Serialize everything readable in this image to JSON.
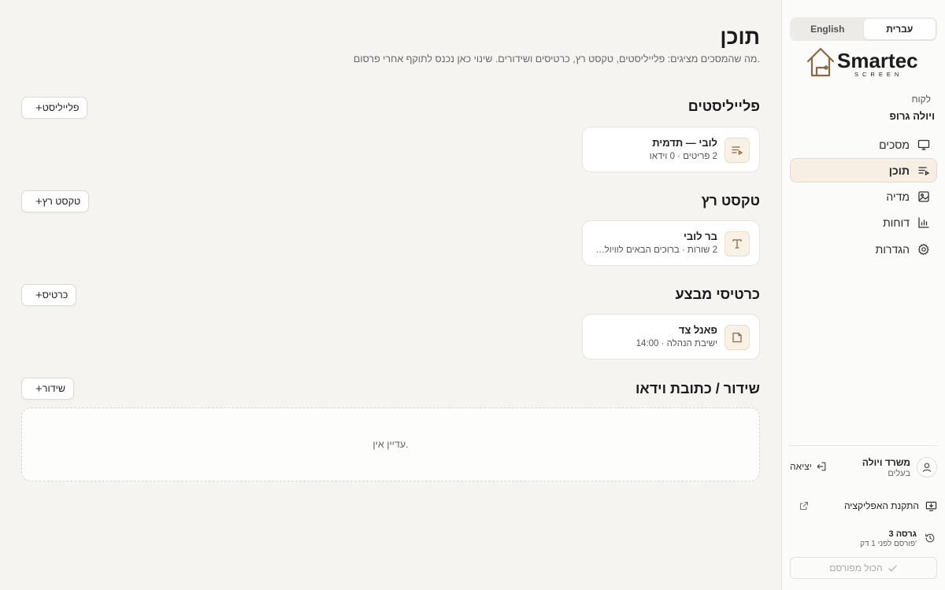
{
  "sidebar": {
    "lang": {
      "active": "עברית",
      "other": "English"
    },
    "logo": {
      "brand": "Smartec",
      "tagline": "SCREEN"
    },
    "client_label": "לקוח",
    "client_name": "ויולה גרופ",
    "nav": [
      {
        "label": "מסכים",
        "icon": "monitor-icon",
        "active": false
      },
      {
        "label": "תוכן",
        "icon": "playlist-icon",
        "active": true
      },
      {
        "label": "מדיה",
        "icon": "image-icon",
        "active": false
      },
      {
        "label": "דוחות",
        "icon": "bar-chart-icon",
        "active": false
      },
      {
        "label": "הגדרות",
        "icon": "gear-icon",
        "active": false
      }
    ],
    "user": {
      "name": "משרד ויולה",
      "role": "בעלים",
      "logout": "יציאה"
    },
    "install_label": "התקנת האפליקציה",
    "version": {
      "title": "גרסה 3",
      "subtitle": "פורסם לפני 1 דק'"
    },
    "published_label": "הכול מפורסם"
  },
  "main": {
    "title": "תוכן",
    "subtitle": "מה שהמסכים מציגים: פלייליסטים, טקסט רץ, כרטיסים ושידורים. שינוי כאן נכנס לתוקף אחרי פרסום.",
    "sections": [
      {
        "title": "פלייליסטים",
        "add_label": "פלייליסט",
        "card": {
          "title": "לובי — תדמית",
          "subtitle": "2 פריטים · 0 וידאו",
          "icon": "playlist-icon"
        }
      },
      {
        "title": "טקסט רץ",
        "add_label": "טקסט רץ",
        "card": {
          "title": "בר לובי",
          "subtitle": "2 שורות · ברוכים הבאים לוויולה גר...",
          "icon": "text-icon"
        }
      },
      {
        "title": "כרטיסי מבצע",
        "add_label": "כרטיס",
        "card": {
          "title": "פאנל צד",
          "subtitle": "ישיבת הנהלה · 14:00",
          "icon": "note-icon"
        }
      },
      {
        "title": "שידור / כתובת וידאו",
        "add_label": "שידור",
        "empty_text": "עדיין אין."
      }
    ]
  },
  "colors": {
    "accent": "#b07b3e",
    "accent_bg": "#f7efe4",
    "background": "#f5f4f1"
  }
}
